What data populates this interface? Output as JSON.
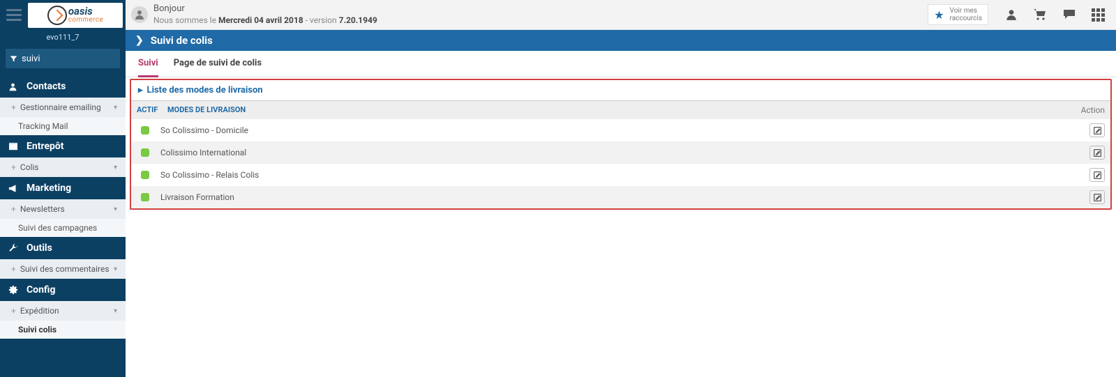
{
  "brand": {
    "line1": "oasis",
    "line2": "commerce"
  },
  "tenant": "evo111_7",
  "filter": {
    "value": "suivi"
  },
  "sidebar": [
    {
      "type": "head",
      "icon": "person",
      "label": "Contacts"
    },
    {
      "type": "sub",
      "label": "Gestionnaire emailing"
    },
    {
      "type": "leaf",
      "label": "Tracking Mail"
    },
    {
      "type": "head",
      "icon": "box",
      "label": "Entrepôt"
    },
    {
      "type": "sub",
      "label": "Colis"
    },
    {
      "type": "head",
      "icon": "megaphone",
      "label": "Marketing"
    },
    {
      "type": "sub",
      "label": "Newsletters"
    },
    {
      "type": "leaf",
      "label": "Suivi des campagnes"
    },
    {
      "type": "head",
      "icon": "wrench",
      "label": "Outils"
    },
    {
      "type": "sub",
      "label": "Suivi des commentaires"
    },
    {
      "type": "head",
      "icon": "gear",
      "label": "Config"
    },
    {
      "type": "sub",
      "label": "Expédition"
    },
    {
      "type": "leaf",
      "label": "Suivi colis",
      "active": true
    }
  ],
  "greeting": {
    "line1": "Bonjour",
    "line2_prefix": "Nous sommes le ",
    "date": "Mercredi 04 avril 2018",
    "version_prefix": " - version ",
    "version": "7.20.1949"
  },
  "shortcut": {
    "line1": "Voir mes",
    "line2": "raccourcis"
  },
  "page_title": "Suivi de colis",
  "tabs": [
    {
      "label": "Suivi",
      "active": true
    },
    {
      "label": "Page de suivi de colis"
    }
  ],
  "panel_title": "Liste des modes de livraison",
  "columns": {
    "actif": "Actif",
    "mode": "Modes de livraison",
    "action": "Action"
  },
  "rows": [
    {
      "actif": true,
      "label": "So Colissimo - Domicile"
    },
    {
      "actif": true,
      "label": "Colissimo International"
    },
    {
      "actif": true,
      "label": "So Colissimo - Relais Colis"
    },
    {
      "actif": true,
      "label": "Livraison Formation"
    }
  ]
}
